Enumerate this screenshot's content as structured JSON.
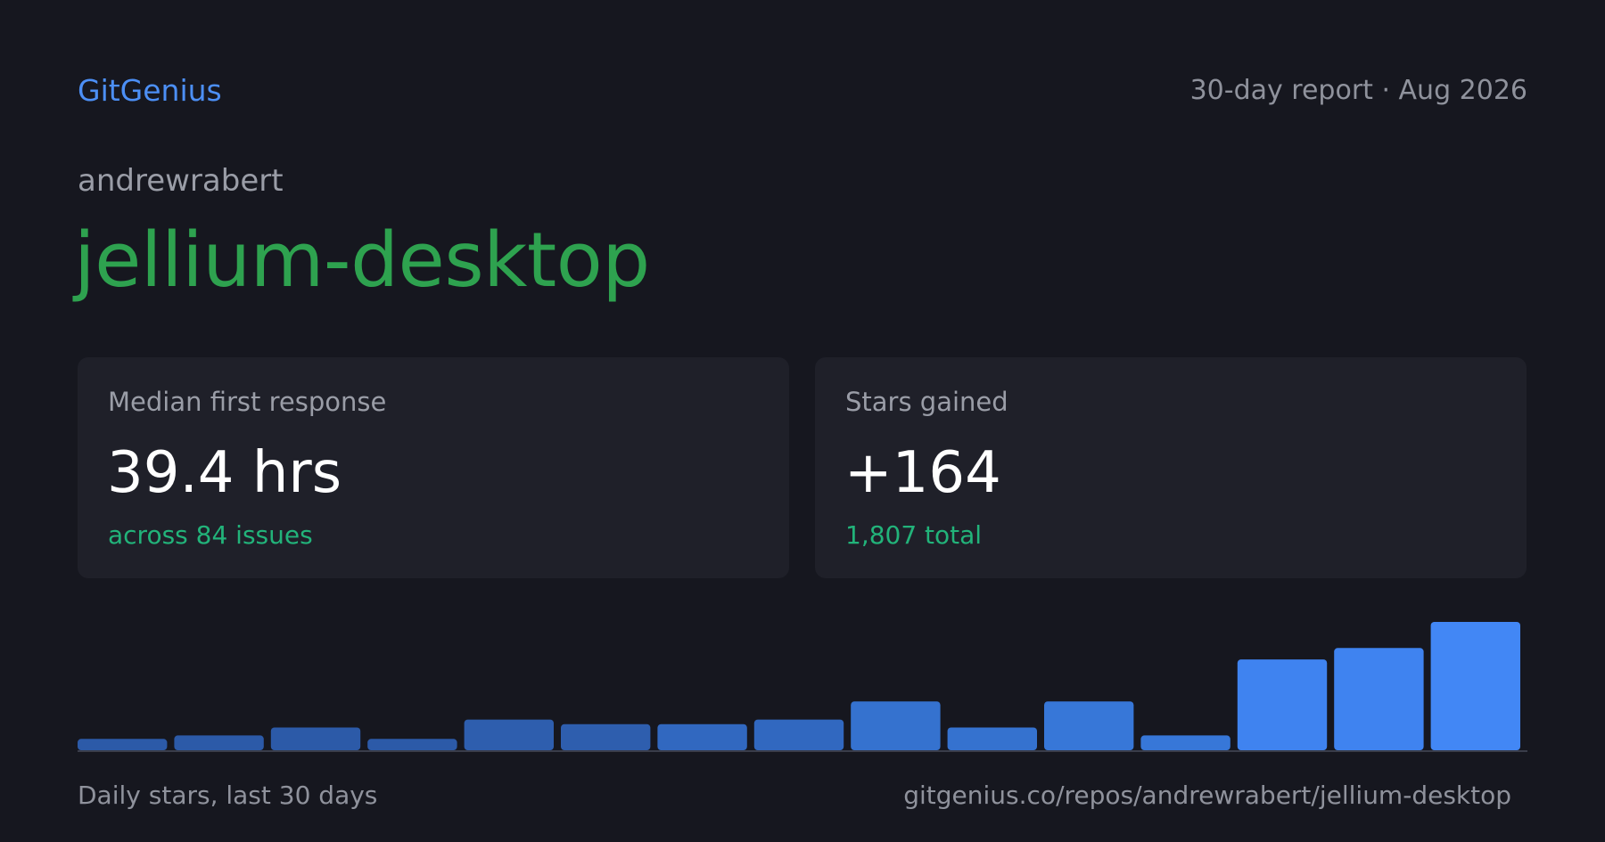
{
  "header": {
    "brand": "GitGenius",
    "report_label": "30-day report · Aug 2026"
  },
  "repo": {
    "owner": "andrewrabert",
    "name": "jellium-desktop"
  },
  "cards": [
    {
      "label": "Median first response",
      "value": "39.4 hrs",
      "sub": "across 84 issues"
    },
    {
      "label": "Stars gained",
      "value": "+164",
      "sub": "1,807 total"
    }
  ],
  "chart_data": {
    "type": "bar",
    "values": [
      1,
      1.3,
      2,
      1,
      2.7,
      2.3,
      2.3,
      2.7,
      4.3,
      2,
      4.3,
      1.3,
      8,
      9,
      11.3
    ],
    "ylim": [
      0,
      11.3
    ],
    "colors": [
      "#2c5aa8",
      "#2c5aa8",
      "#2c5aa8",
      "#2c5aa8",
      "#2e5eae",
      "#2e5eae",
      "#3168c0",
      "#3168c0",
      "#3572cf",
      "#3572cf",
      "#3777d8",
      "#3777d8",
      "#3f83f0",
      "#3f83f0",
      "#4287f5"
    ]
  },
  "footer": {
    "caption": "Daily stars, last 30 days",
    "url": "gitgenius.co/repos/andrewrabert/jellium-desktop"
  }
}
